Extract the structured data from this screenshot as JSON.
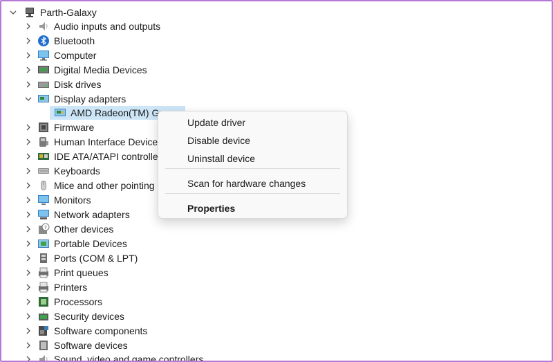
{
  "root": {
    "label": "Parth-Galaxy",
    "expanded": true
  },
  "categories": [
    {
      "label": "Audio inputs and outputs",
      "icon": "speaker-icon",
      "expanded": false
    },
    {
      "label": "Bluetooth",
      "icon": "bluetooth-icon",
      "expanded": false
    },
    {
      "label": "Computer",
      "icon": "computer-icon",
      "expanded": false
    },
    {
      "label": "Digital Media Devices",
      "icon": "media-device-icon",
      "expanded": false
    },
    {
      "label": "Disk drives",
      "icon": "disk-drive-icon",
      "expanded": false
    },
    {
      "label": "Display adapters",
      "icon": "display-adapter-icon",
      "expanded": true
    },
    {
      "label": "Firmware",
      "icon": "firmware-icon",
      "expanded": false
    },
    {
      "label": "Human Interface Devices",
      "icon": "hid-icon",
      "expanded": false
    },
    {
      "label": "IDE ATA/ATAPI controllers",
      "icon": "ide-controller-icon",
      "expanded": false
    },
    {
      "label": "Keyboards",
      "icon": "keyboard-icon",
      "expanded": false
    },
    {
      "label": "Mice and other pointing",
      "icon": "mouse-icon",
      "expanded": false
    },
    {
      "label": "Monitors",
      "icon": "monitor-icon",
      "expanded": false
    },
    {
      "label": "Network adapters",
      "icon": "network-adapter-icon",
      "expanded": false
    },
    {
      "label": "Other devices",
      "icon": "unknown-device-icon",
      "expanded": false
    },
    {
      "label": "Portable Devices",
      "icon": "portable-device-icon",
      "expanded": false
    },
    {
      "label": "Ports (COM & LPT)",
      "icon": "port-icon",
      "expanded": false
    },
    {
      "label": "Print queues",
      "icon": "print-queue-icon",
      "expanded": false
    },
    {
      "label": "Printers",
      "icon": "printer-icon",
      "expanded": false
    },
    {
      "label": "Processors",
      "icon": "processor-icon",
      "expanded": false
    },
    {
      "label": "Security devices",
      "icon": "security-device-icon",
      "expanded": false
    },
    {
      "label": "Software components",
      "icon": "software-component-icon",
      "expanded": false
    },
    {
      "label": "Software devices",
      "icon": "software-device-icon",
      "expanded": false
    },
    {
      "label": "Sound, video and game controllers",
      "icon": "sound-controller-icon",
      "expanded": false
    }
  ],
  "display_adapter_child": {
    "label": "AMD Radeon(TM) Graphics",
    "visible_label": "AMD Radeon(TM) Gra",
    "selected": true
  },
  "context_menu": {
    "items": [
      {
        "label": "Update driver"
      },
      {
        "label": "Disable device"
      },
      {
        "label": "Uninstall device"
      },
      {
        "label": "Scan for hardware changes"
      },
      {
        "label": "Properties",
        "bold": true
      }
    ]
  },
  "colors": {
    "selection": "#cde6f7",
    "frame_border": "#b57ad6",
    "menu_bg": "#f9f9f9"
  }
}
